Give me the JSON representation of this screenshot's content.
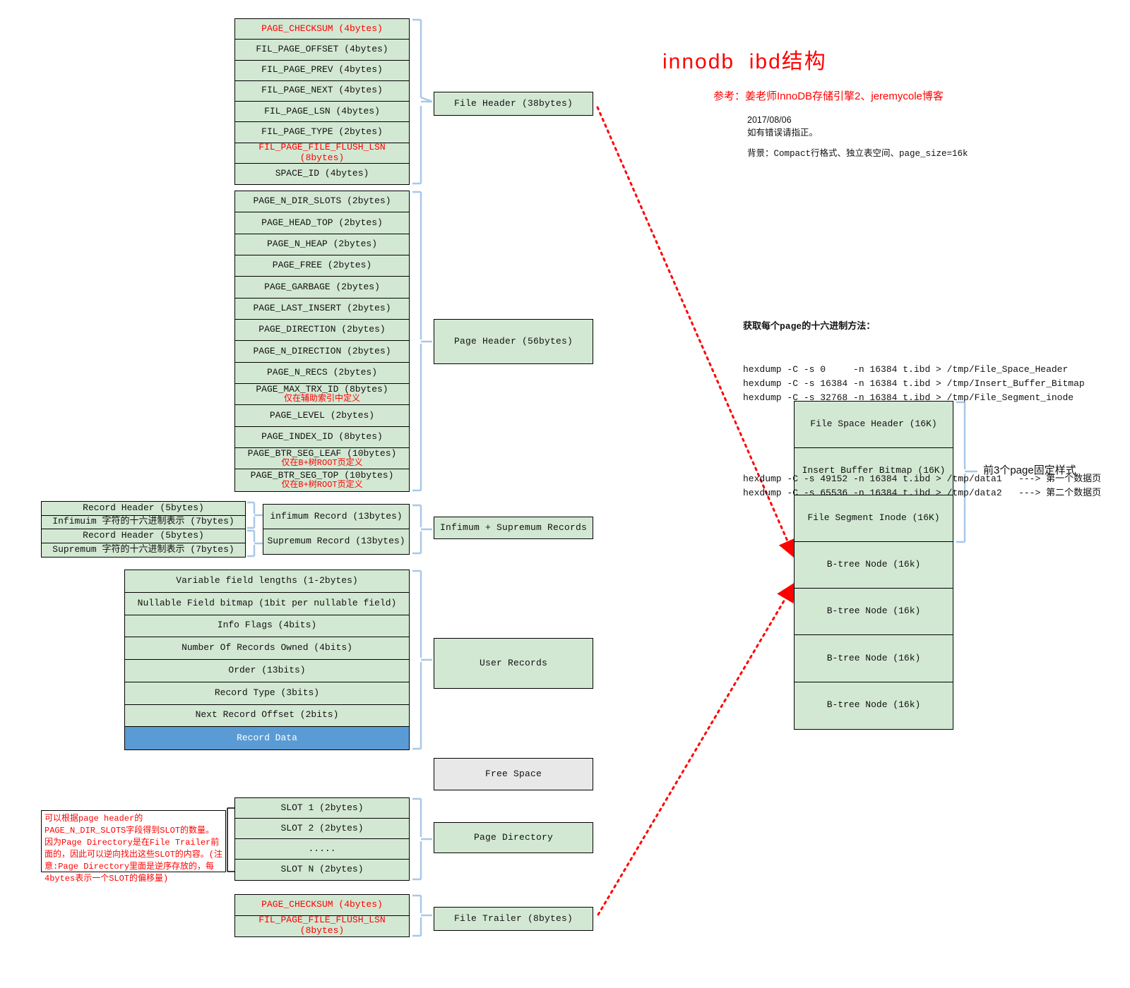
{
  "header": {
    "title": "innodb  ibd结构",
    "reference": "参考：姜老师InnoDB存储引擎2、jeremycole博客",
    "date": "2017/08/06",
    "correction": "如有错误请指正。",
    "background": "背景：Compact行格式、独立表空间、page_size=16k",
    "title_color": "#ff0000"
  },
  "hexdump": {
    "heading": "获取每个page的十六进制方法：",
    "lines": [
      "hexdump -C -s 0     -n 16384 t.ibd > /tmp/File_Space_Header",
      "hexdump -C -s 16384 -n 16384 t.ibd > /tmp/Insert_Buffer_Bitmap",
      "hexdump -C -s 32768 -n 16384 t.ibd > /tmp/File_Segment_inode"
    ],
    "lines2": [
      "hexdump -C -s 49152 -n 16384 t.ibd > /tmp/data1   ---> 第一个数据页",
      "hexdump -C -s 65536 -n 16384 t.ibd > /tmp/data2   ---> 第二个数据页"
    ]
  },
  "file_header": {
    "label": "File Header (38bytes)",
    "fields": [
      {
        "text": "PAGE_CHECKSUM   (4bytes)",
        "red": true
      },
      {
        "text": "FIL_PAGE_OFFSET   (4bytes)",
        "red": false
      },
      {
        "text": "FIL_PAGE_PREV   (4bytes)",
        "red": false
      },
      {
        "text": "FIL_PAGE_NEXT   (4bytes)",
        "red": false
      },
      {
        "text": "FIL_PAGE_LSN   (4bytes)",
        "red": false
      },
      {
        "text": "FIL_PAGE_TYPE   (2bytes)",
        "red": false
      },
      {
        "text": "FIL_PAGE_FILE_FLUSH_LSN   (8bytes)",
        "red": true
      },
      {
        "text": "SPACE_ID   (4bytes)",
        "red": false
      }
    ]
  },
  "page_header": {
    "label": "Page Header (56bytes)",
    "fields": [
      {
        "text": "PAGE_N_DIR_SLOTS   (2bytes)",
        "note": ""
      },
      {
        "text": "PAGE_HEAD_TOP   (2bytes)",
        "note": ""
      },
      {
        "text": "PAGE_N_HEAP   (2bytes)",
        "note": ""
      },
      {
        "text": "PAGE_FREE   (2bytes)",
        "note": ""
      },
      {
        "text": "PAGE_GARBAGE   (2bytes)",
        "note": ""
      },
      {
        "text": "PAGE_LAST_INSERT   (2bytes)",
        "note": ""
      },
      {
        "text": "PAGE_DIRECTION   (2bytes)",
        "note": ""
      },
      {
        "text": "PAGE_N_DIRECTION   (2bytes)",
        "note": ""
      },
      {
        "text": "PAGE_N_RECS   (2bytes)",
        "note": ""
      },
      {
        "text": "PAGE_MAX_TRX_ID   (8bytes)",
        "note": "仅在辅助索引中定义"
      },
      {
        "text": "PAGE_LEVEL   (2bytes)",
        "note": ""
      },
      {
        "text": "PAGE_INDEX_ID   (8bytes)",
        "note": ""
      },
      {
        "text": "PAGE_BTR_SEG_LEAF   (10bytes)",
        "note": "仅在B+树ROOT页定义"
      },
      {
        "text": "PAGE_BTR_SEG_TOP   (10bytes)",
        "note": "仅在B+树ROOT页定义"
      }
    ]
  },
  "record_headers": {
    "rows": [
      "Record Header (5bytes)",
      "Infimuim 字符的十六进制表示   (7bytes)",
      "Record Header (5bytes)",
      "Supremum 字符的十六进制表示   (7bytes)"
    ]
  },
  "inf_sup": {
    "label": "Infimum + Supremum Records",
    "rows": [
      "infimum Record   (13bytes)",
      "Supremum Record   (13bytes)"
    ]
  },
  "user_records": {
    "label": "User Records",
    "fields": [
      {
        "text": "Variable field lengths  (1-2bytes)",
        "fill": "green"
      },
      {
        "text": "Nullable Field bitmap  (1bit per nullable field)",
        "fill": "green"
      },
      {
        "text": "Info Flags  (4bits)",
        "fill": "green"
      },
      {
        "text": "Number Of Records Owned  (4bits)",
        "fill": "green"
      },
      {
        "text": "Order  (13bits)",
        "fill": "green"
      },
      {
        "text": "Record Type  (3bits)",
        "fill": "green"
      },
      {
        "text": "Next Record Offset  (2bits)",
        "fill": "green"
      },
      {
        "text": "Record Data",
        "fill": "blue"
      }
    ]
  },
  "free_space": {
    "label": "Free Space"
  },
  "page_directory": {
    "label": "Page Directory",
    "fields": [
      "SLOT 1   (2bytes)",
      "SLOT 2   (2bytes)",
      ".....",
      "SLOT N   (2bytes)"
    ],
    "note": "可以根据page header的PAGE_N_DIR_SLOTS字段得到SLOT的数量。因为Page Directory是在File Trailer前面的，因此可以逆向找出这些SLOT的内容。(注意:Page Directory里面是逆序存放的，每4bytes表示一个SLOT的偏移量)"
  },
  "file_trailer": {
    "label": "File Trailer (8bytes)",
    "fields": [
      {
        "text": "PAGE_CHECKSUM   (4bytes)",
        "red": true
      },
      {
        "text": "FIL_PAGE_FILE_FLUSH_LSN   (8bytes)",
        "red": true
      }
    ]
  },
  "page_stack": {
    "fixed_note": "前3个page固定样式",
    "pages": [
      "File Space Header (16K)",
      "Insert Buffer Bitmap (16K)",
      "File Segment Inode (16K)",
      "B-tree Node  (16k)",
      "B-tree Node  (16k)",
      "B-tree Node  (16k)",
      "B-tree Node  (16k)"
    ]
  },
  "colors": {
    "green_fill": "#d3e8d3",
    "blue_fill": "#5b9bd5",
    "grey_fill": "#e8e8e8",
    "accent_red": "#ff0000",
    "brace_blue": "#a8c8e8"
  }
}
